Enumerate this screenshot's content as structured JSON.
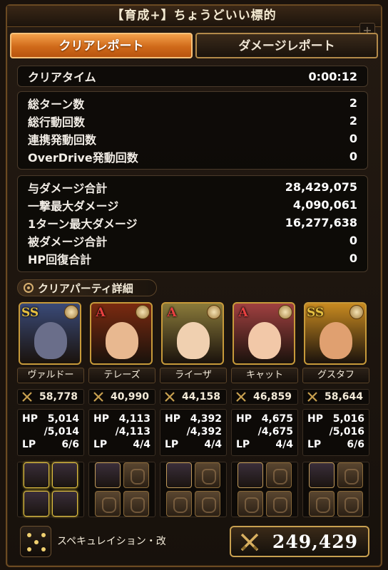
{
  "window": {
    "title": "【育成+】ちょうどいい標的"
  },
  "tabs": [
    {
      "label": "クリアレポート",
      "active": true
    },
    {
      "label": "ダメージレポート",
      "active": false
    }
  ],
  "clear_time": {
    "label": "クリアタイム",
    "value": "0:00:12"
  },
  "turn_stats": [
    {
      "label": "総ターン数",
      "value": "2"
    },
    {
      "label": "総行動回数",
      "value": "2"
    },
    {
      "label": "連携発動回数",
      "value": "0"
    },
    {
      "label": "OverDrive発動回数",
      "value": "0"
    }
  ],
  "damage_stats": [
    {
      "label": "与ダメージ合計",
      "value": "28,429,075"
    },
    {
      "label": "一撃最大ダメージ",
      "value": "4,090,061"
    },
    {
      "label": "1ターン最大ダメージ",
      "value": "16,277,638"
    },
    {
      "label": "被ダメージ合計",
      "value": "0"
    },
    {
      "label": "HP回復合計",
      "value": "0"
    }
  ],
  "party_section": {
    "label": "クリアパーティ詳細"
  },
  "party": [
    {
      "rank": "SS",
      "name": "ヴァルドー",
      "power": "58,778",
      "hp_label": "HP",
      "hp_cur": "5,014",
      "hp_max": "/5,014",
      "lp_label": "LP",
      "lp": "6/6",
      "rank_color": "#e6c040",
      "portrait_bg": "#3a4a78",
      "face_color": "#6a6e8a"
    },
    {
      "rank": "A",
      "name": "テレーズ",
      "power": "40,990",
      "hp_label": "HP",
      "hp_cur": "4,113",
      "hp_max": "/4,113",
      "lp_label": "LP",
      "lp": "4/4",
      "rank_color": "#e84040",
      "portrait_bg": "#7a2a10",
      "face_color": "#e8b890"
    },
    {
      "rank": "A",
      "name": "ライーザ",
      "power": "44,158",
      "hp_label": "HP",
      "hp_cur": "4,392",
      "hp_max": "/4,392",
      "lp_label": "LP",
      "lp": "4/4",
      "rank_color": "#e84040",
      "portrait_bg": "#8a7a3a",
      "face_color": "#f0d0b0"
    },
    {
      "rank": "A",
      "name": "キャット",
      "power": "46,859",
      "hp_label": "HP",
      "hp_cur": "4,675",
      "hp_max": "/4,675",
      "lp_label": "LP",
      "lp": "4/4",
      "rank_color": "#e84040",
      "portrait_bg": "#a04040",
      "face_color": "#f2c8a8"
    },
    {
      "rank": "SS",
      "name": "グスタフ",
      "power": "58,644",
      "hp_label": "HP",
      "hp_cur": "5,016",
      "hp_max": "/5,016",
      "lp_label": "LP",
      "lp": "6/6",
      "rank_color": "#e6c040",
      "portrait_bg": "#c88a20",
      "face_color": "#e0a070"
    }
  ],
  "bottom": {
    "skill_name": "スペキュレイション・改",
    "total_power": "249,429"
  },
  "colors": {
    "tab_active": "#e07a22",
    "frame_gold": "#c8a050",
    "panel_bg": "#0a0806"
  },
  "icons": [
    "plus-icon",
    "gear-icon",
    "sword-icon",
    "dice-icon",
    "crossed-swords-icon"
  ]
}
